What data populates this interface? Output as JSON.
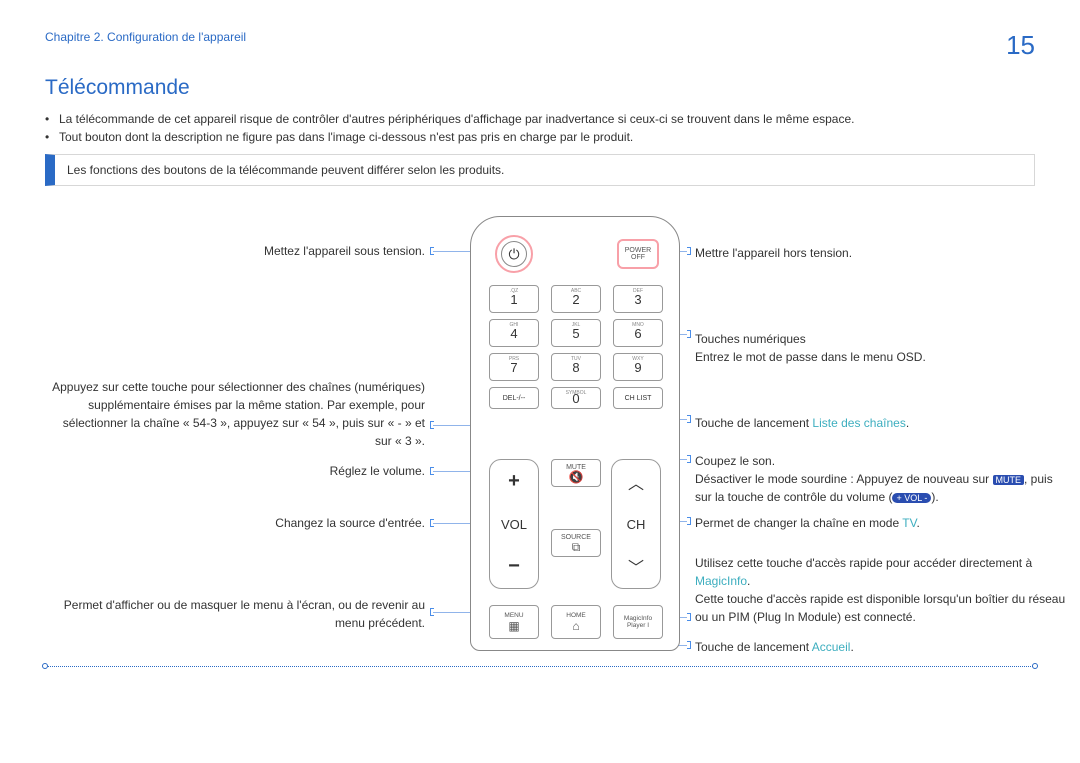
{
  "header": {
    "chapter": "Chapitre 2. Configuration de l'appareil",
    "page": "15"
  },
  "title": "Télécommande",
  "bullets": [
    "La télécommande de cet appareil risque de contrôler d'autres périphériques d'affichage par inadvertance si ceux-ci se trouvent dans le même espace.",
    "Tout bouton dont la description ne figure pas dans l'image ci-dessous n'est pas pris en charge par le produit."
  ],
  "note": "Les fonctions des boutons de la télécommande peuvent différer selon les produits.",
  "remote": {
    "power_off_top": "POWER",
    "power_off_bottom": "OFF",
    "keys": [
      {
        "n": "1",
        "s": ".QZ"
      },
      {
        "n": "2",
        "s": "ABC"
      },
      {
        "n": "3",
        "s": "DEF"
      },
      {
        "n": "4",
        "s": "GHI"
      },
      {
        "n": "5",
        "s": "JKL"
      },
      {
        "n": "6",
        "s": "MNO"
      },
      {
        "n": "7",
        "s": "PRS"
      },
      {
        "n": "8",
        "s": "TUV"
      },
      {
        "n": "9",
        "s": "WXY"
      }
    ],
    "rkeys": [
      "DEL-/--",
      "SYMBOL",
      ""
    ],
    "zero": "0",
    "chlist": "CH LIST",
    "vol": "VOL",
    "ch": "CH",
    "mute": "MUTE",
    "source": "SOURCE",
    "menu": "MENU",
    "home": "HOME",
    "magicinfo_top": "MagicInfo",
    "magicinfo_bot": "Player I"
  },
  "left_labels": {
    "power_on": "Mettez l'appareil sous tension.",
    "numeric": "Appuyez sur cette touche pour sélectionner des chaînes (numériques) supplémentaire émises par la même station. Par exemple, pour sélectionner la chaîne « 54-3 », appuyez sur « 54 », puis sur « - » et sur « 3 ».",
    "volume": "Réglez le volume.",
    "source": "Changez la source d'entrée.",
    "menu": "Permet d'afficher ou de masquer le menu à l'écran, ou de revenir au menu précédent."
  },
  "right_labels": {
    "power_off": "Mettre l'appareil hors tension.",
    "numeric_a": "Touches numériques",
    "numeric_b": "Entrez le mot de passe dans le menu OSD.",
    "chlist_a": "Touche de lancement ",
    "chlist_link": "Liste des chaînes",
    "mute_a": "Coupez le son.",
    "mute_b1": "Désactiver le mode sourdine : Appuyez de nouveau sur ",
    "mute_pill": "MUTE",
    "mute_b2": ", puis",
    "mute_c1": "sur la touche de contrôle du volume (",
    "vol_pill": "+ VOL -",
    "mute_c2": ").",
    "ch_a": "Permet de changer la chaîne en mode ",
    "tv_link": "TV",
    "magic_a": "Utilisez cette touche d'accès rapide pour accéder directement à ",
    "magic_link": "MagicInfo",
    "magic_b": "Cette touche d'accès rapide est disponible lorsqu'un boîtier du réseau ou un PIM (Plug In Module) est connecté.",
    "home_a": "Touche de lancement ",
    "home_link": "Accueil"
  }
}
